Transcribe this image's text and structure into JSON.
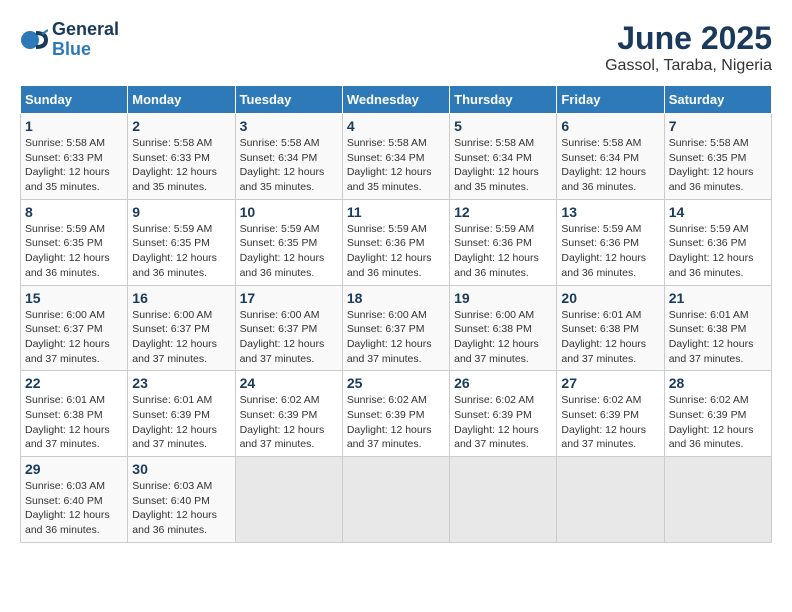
{
  "logo": {
    "line1": "General",
    "line2": "Blue"
  },
  "title": "June 2025",
  "subtitle": "Gassol, Taraba, Nigeria",
  "days_of_week": [
    "Sunday",
    "Monday",
    "Tuesday",
    "Wednesday",
    "Thursday",
    "Friday",
    "Saturday"
  ],
  "weeks": [
    [
      {
        "day": "1",
        "sunrise": "5:58 AM",
        "sunset": "6:33 PM",
        "daylight": "12 hours and 35 minutes."
      },
      {
        "day": "2",
        "sunrise": "5:58 AM",
        "sunset": "6:33 PM",
        "daylight": "12 hours and 35 minutes."
      },
      {
        "day": "3",
        "sunrise": "5:58 AM",
        "sunset": "6:34 PM",
        "daylight": "12 hours and 35 minutes."
      },
      {
        "day": "4",
        "sunrise": "5:58 AM",
        "sunset": "6:34 PM",
        "daylight": "12 hours and 35 minutes."
      },
      {
        "day": "5",
        "sunrise": "5:58 AM",
        "sunset": "6:34 PM",
        "daylight": "12 hours and 35 minutes."
      },
      {
        "day": "6",
        "sunrise": "5:58 AM",
        "sunset": "6:34 PM",
        "daylight": "12 hours and 36 minutes."
      },
      {
        "day": "7",
        "sunrise": "5:58 AM",
        "sunset": "6:35 PM",
        "daylight": "12 hours and 36 minutes."
      }
    ],
    [
      {
        "day": "8",
        "sunrise": "5:59 AM",
        "sunset": "6:35 PM",
        "daylight": "12 hours and 36 minutes."
      },
      {
        "day": "9",
        "sunrise": "5:59 AM",
        "sunset": "6:35 PM",
        "daylight": "12 hours and 36 minutes."
      },
      {
        "day": "10",
        "sunrise": "5:59 AM",
        "sunset": "6:35 PM",
        "daylight": "12 hours and 36 minutes."
      },
      {
        "day": "11",
        "sunrise": "5:59 AM",
        "sunset": "6:36 PM",
        "daylight": "12 hours and 36 minutes."
      },
      {
        "day": "12",
        "sunrise": "5:59 AM",
        "sunset": "6:36 PM",
        "daylight": "12 hours and 36 minutes."
      },
      {
        "day": "13",
        "sunrise": "5:59 AM",
        "sunset": "6:36 PM",
        "daylight": "12 hours and 36 minutes."
      },
      {
        "day": "14",
        "sunrise": "5:59 AM",
        "sunset": "6:36 PM",
        "daylight": "12 hours and 36 minutes."
      }
    ],
    [
      {
        "day": "15",
        "sunrise": "6:00 AM",
        "sunset": "6:37 PM",
        "daylight": "12 hours and 37 minutes."
      },
      {
        "day": "16",
        "sunrise": "6:00 AM",
        "sunset": "6:37 PM",
        "daylight": "12 hours and 37 minutes."
      },
      {
        "day": "17",
        "sunrise": "6:00 AM",
        "sunset": "6:37 PM",
        "daylight": "12 hours and 37 minutes."
      },
      {
        "day": "18",
        "sunrise": "6:00 AM",
        "sunset": "6:37 PM",
        "daylight": "12 hours and 37 minutes."
      },
      {
        "day": "19",
        "sunrise": "6:00 AM",
        "sunset": "6:38 PM",
        "daylight": "12 hours and 37 minutes."
      },
      {
        "day": "20",
        "sunrise": "6:01 AM",
        "sunset": "6:38 PM",
        "daylight": "12 hours and 37 minutes."
      },
      {
        "day": "21",
        "sunrise": "6:01 AM",
        "sunset": "6:38 PM",
        "daylight": "12 hours and 37 minutes."
      }
    ],
    [
      {
        "day": "22",
        "sunrise": "6:01 AM",
        "sunset": "6:38 PM",
        "daylight": "12 hours and 37 minutes."
      },
      {
        "day": "23",
        "sunrise": "6:01 AM",
        "sunset": "6:39 PM",
        "daylight": "12 hours and 37 minutes."
      },
      {
        "day": "24",
        "sunrise": "6:02 AM",
        "sunset": "6:39 PM",
        "daylight": "12 hours and 37 minutes."
      },
      {
        "day": "25",
        "sunrise": "6:02 AM",
        "sunset": "6:39 PM",
        "daylight": "12 hours and 37 minutes."
      },
      {
        "day": "26",
        "sunrise": "6:02 AM",
        "sunset": "6:39 PM",
        "daylight": "12 hours and 37 minutes."
      },
      {
        "day": "27",
        "sunrise": "6:02 AM",
        "sunset": "6:39 PM",
        "daylight": "12 hours and 37 minutes."
      },
      {
        "day": "28",
        "sunrise": "6:02 AM",
        "sunset": "6:39 PM",
        "daylight": "12 hours and 36 minutes."
      }
    ],
    [
      {
        "day": "29",
        "sunrise": "6:03 AM",
        "sunset": "6:40 PM",
        "daylight": "12 hours and 36 minutes."
      },
      {
        "day": "30",
        "sunrise": "6:03 AM",
        "sunset": "6:40 PM",
        "daylight": "12 hours and 36 minutes."
      },
      null,
      null,
      null,
      null,
      null
    ]
  ],
  "labels": {
    "sunrise": "Sunrise:",
    "sunset": "Sunset:",
    "daylight": "Daylight:"
  }
}
